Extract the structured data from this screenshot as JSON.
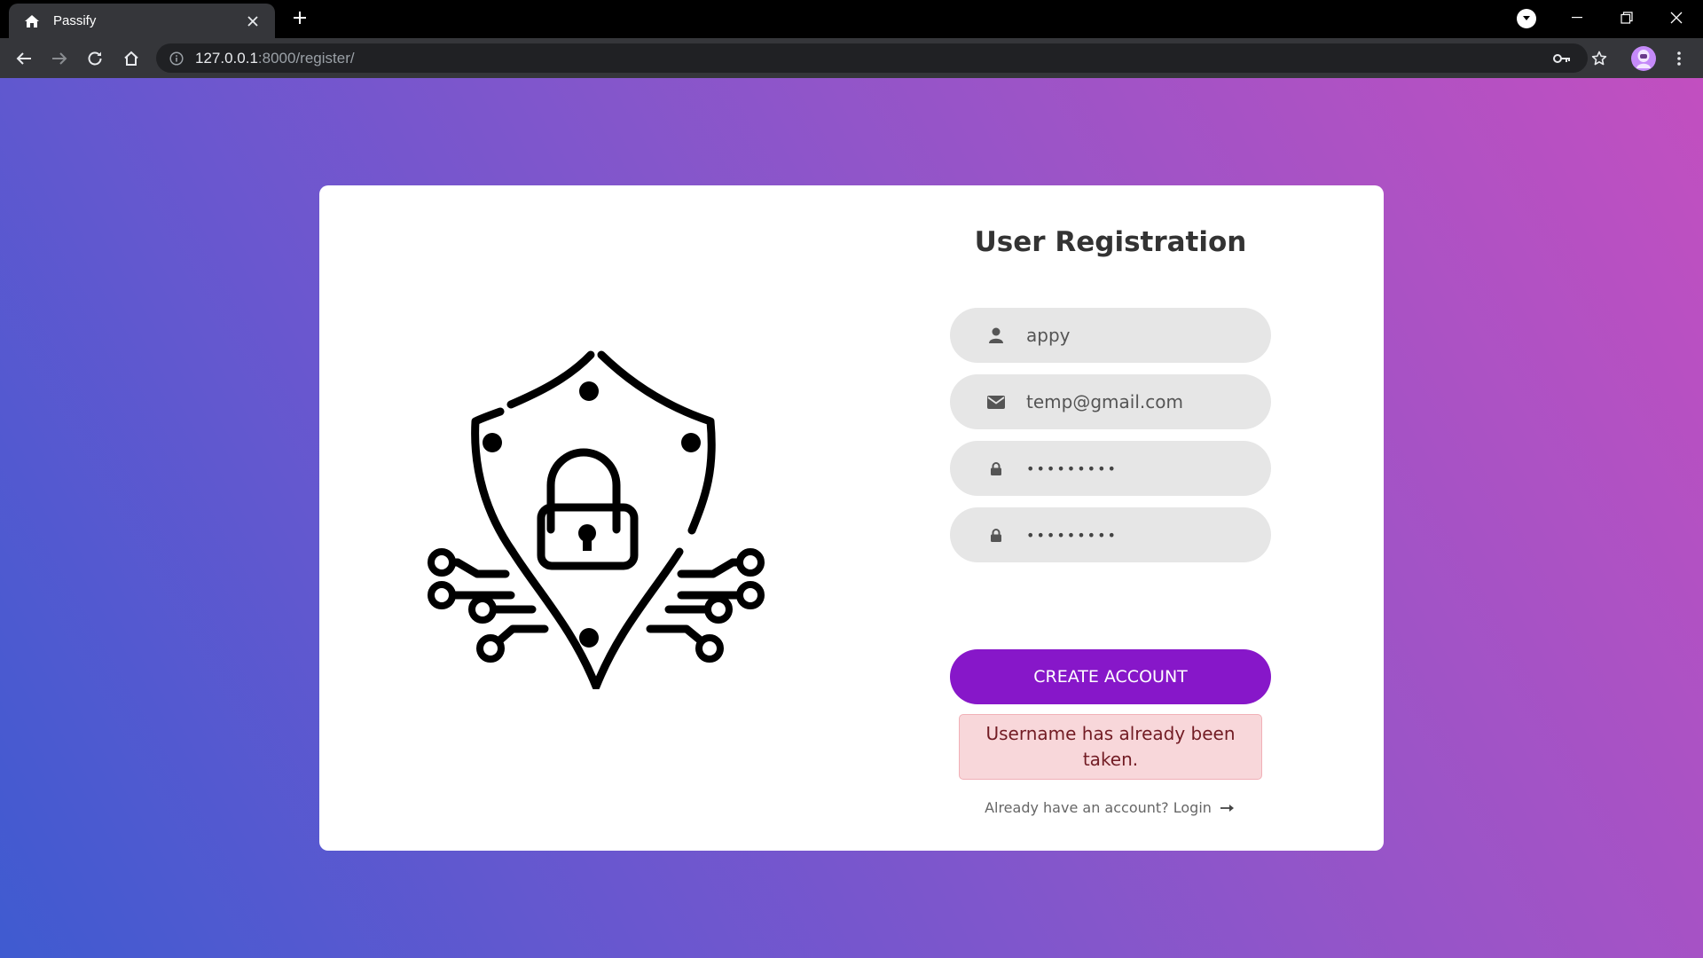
{
  "browser": {
    "tab_title": "Passify",
    "url_host": "127.0.0.1",
    "url_rest": ":8000/register/",
    "icons": {
      "favicon": "home-icon",
      "close_tab": "close-icon",
      "new_tab": "plus-icon",
      "back": "arrow-left-icon",
      "forward": "arrow-right-icon",
      "reload": "reload-icon",
      "home": "home-icon",
      "site_info": "info-icon",
      "password_key": "key-icon",
      "bookmark": "star-icon",
      "menu": "kebab-menu-icon"
    }
  },
  "page": {
    "title": "User Registration",
    "fields": {
      "username": "appy",
      "email": "temp@gmail.com",
      "password": "•••••••••",
      "confirm_password": "•••••••••"
    },
    "create_button": "CREATE ACCOUNT",
    "error_message": "Username has already been taken.",
    "login_prompt": "Already have an account?",
    "login_link": "Login",
    "colors": {
      "accent": "#8717c9",
      "gradient_start": "#3f5bd0",
      "gradient_end": "#c24fc0",
      "error_bg": "#f8d7da",
      "error_text": "#721c24"
    }
  }
}
